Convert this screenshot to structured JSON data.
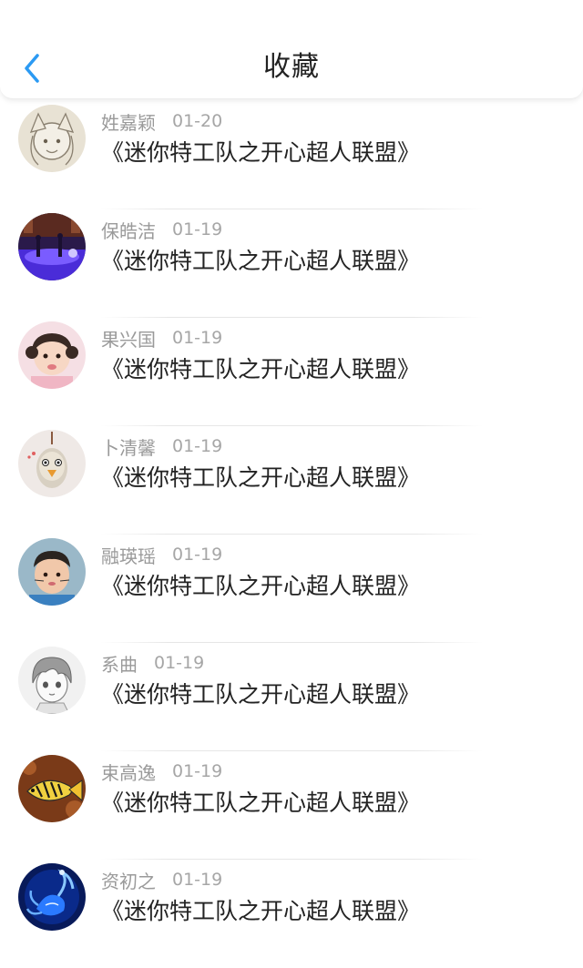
{
  "header": {
    "title": "收藏",
    "back_icon": "chevron-left-icon",
    "accent_color": "#2b9af3"
  },
  "list": {
    "items": [
      {
        "name": "姓嘉颖",
        "date": "01-20",
        "title": "《迷你特工队之开心超人联盟》",
        "avatar": "anime-sketch-avatar"
      },
      {
        "name": "保皓洁",
        "date": "01-19",
        "title": "《迷你特工队之开心超人联盟》",
        "avatar": "purple-stage-avatar"
      },
      {
        "name": "果兴国",
        "date": "01-19",
        "title": "《迷你特工队之开心超人联盟》",
        "avatar": "child-photo-avatar"
      },
      {
        "name": "卜清馨",
        "date": "01-19",
        "title": "《迷你特工队之开心超人联盟》",
        "avatar": "bird-toy-avatar"
      },
      {
        "name": "融瑛瑶",
        "date": "01-19",
        "title": "《迷你特工队之开心超人联盟》",
        "avatar": "kid-photo-avatar"
      },
      {
        "name": "系曲",
        "date": "01-19",
        "title": "《迷你特工队之开心超人联盟》",
        "avatar": "manga-boy-avatar"
      },
      {
        "name": "束高逸",
        "date": "01-19",
        "title": "《迷你特工队之开心超人联盟》",
        "avatar": "tropical-fish-avatar"
      },
      {
        "name": "资初之",
        "date": "01-19",
        "title": "《迷你特工队之开心超人联盟》",
        "avatar": "blue-scorpion-avatar"
      }
    ]
  }
}
